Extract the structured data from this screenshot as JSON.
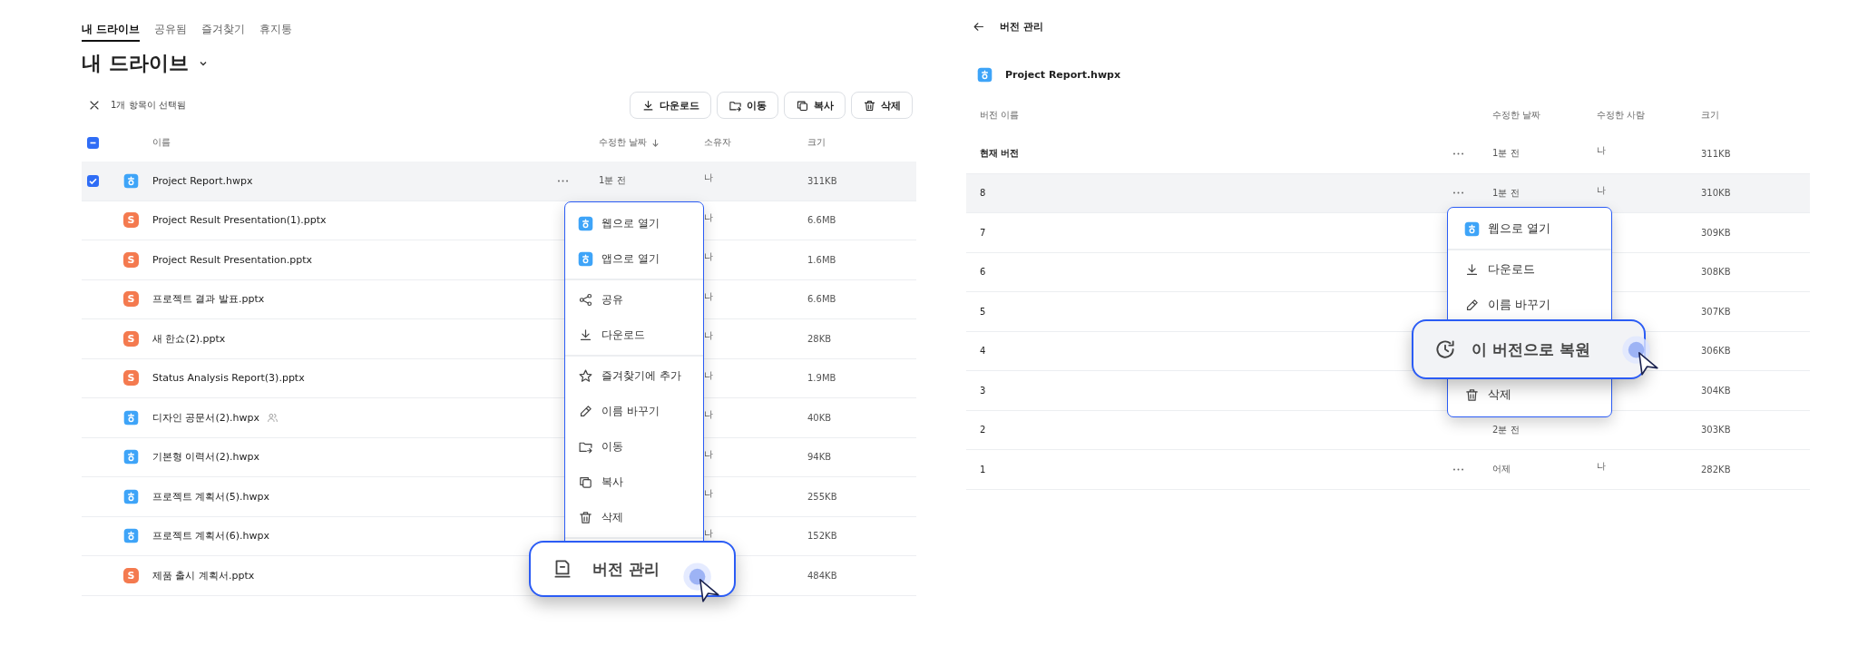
{
  "left": {
    "tabs": [
      {
        "label": "내 드라이브",
        "selected": true
      },
      {
        "label": "공유됨",
        "selected": false
      },
      {
        "label": "즐겨찾기",
        "selected": false
      },
      {
        "label": "휴지통",
        "selected": false
      }
    ],
    "title": "내 드라이브",
    "selection_text": "1개 항목이 선택됨",
    "actions": [
      {
        "label": "다운로드",
        "kind": "download"
      },
      {
        "label": "이동",
        "kind": "folder"
      },
      {
        "label": "복사",
        "kind": "copy"
      },
      {
        "label": "삭제",
        "kind": "trash"
      }
    ],
    "header_checkbox": {
      "kind": "partial"
    },
    "columns": [
      {
        "label": "이름",
        "sorted": false
      },
      {
        "label": "수정한 날짜",
        "sorted": true
      },
      {
        "label": "소유자",
        "sorted": false
      },
      {
        "label": "크기",
        "sorted": false
      }
    ],
    "rows": [
      {
        "name": "Project Report.hwpx",
        "kind": "hwp",
        "selected": true,
        "shared": false,
        "more": true,
        "modified": "1분 전",
        "owner": "나",
        "size": "311KB"
      },
      {
        "name": "Project Result Presentation(1).pptx",
        "kind": "show",
        "badge": "S",
        "selected": false,
        "shared": false,
        "more": false,
        "owner": "나",
        "size": "6.6MB"
      },
      {
        "name": "Project Result Presentation.pptx",
        "kind": "show",
        "badge": "S",
        "selected": false,
        "shared": false,
        "more": false,
        "owner": "나",
        "size": "1.6MB"
      },
      {
        "name": "프로젝트 결과 발표.pptx",
        "kind": "show",
        "badge": "S",
        "selected": false,
        "shared": false,
        "more": false,
        "owner": "나",
        "size": "6.6MB"
      },
      {
        "name": "새 한쇼(2).pptx",
        "kind": "show",
        "badge": "S",
        "selected": false,
        "shared": false,
        "more": false,
        "owner": "나",
        "size": "28KB"
      },
      {
        "name": "Status Analysis Report(3).pptx",
        "kind": "show",
        "badge": "S",
        "selected": false,
        "shared": false,
        "more": false,
        "owner": "나",
        "size": "1.9MB"
      },
      {
        "name": "디자인 공문서(2).hwpx",
        "kind": "hwp",
        "selected": false,
        "shared": true,
        "more": false,
        "owner": "나",
        "size": "40KB"
      },
      {
        "name": "기본형 이력서(2).hwpx",
        "kind": "hwp",
        "selected": false,
        "shared": false,
        "more": false,
        "owner": "나",
        "size": "94KB"
      },
      {
        "name": "프로젝트 계획서(5).hwpx",
        "kind": "hwp",
        "selected": false,
        "shared": false,
        "more": false,
        "owner": "나",
        "size": "255KB"
      },
      {
        "name": "프로젝트 계획서(6).hwpx",
        "kind": "hwp",
        "selected": false,
        "shared": false,
        "more": false,
        "owner": "나",
        "size": "152KB"
      },
      {
        "name": "제품 출시 계획서.pptx",
        "kind": "show",
        "badge": "S",
        "selected": false,
        "shared": false,
        "more": false,
        "size": "484KB"
      }
    ],
    "menu": {
      "items": [
        {
          "label": "웹으로 열기",
          "kind": "hwp",
          "magnified": false,
          "divider_after": false
        },
        {
          "label": "앱으로 열기",
          "kind": "hwp",
          "magnified": false,
          "divider_after": true
        },
        {
          "label": "공유",
          "kind": "share",
          "magnified": false,
          "divider_after": false
        },
        {
          "label": "다운로드",
          "kind": "download",
          "magnified": false,
          "divider_after": true
        },
        {
          "label": "즐겨찾기에 추가",
          "kind": "star",
          "magnified": false,
          "divider_after": false
        },
        {
          "label": "이름 바꾸기",
          "kind": "pencil",
          "magnified": false,
          "divider_after": false
        },
        {
          "label": "이동",
          "kind": "folder",
          "magnified": false,
          "divider_after": false
        },
        {
          "label": "복사",
          "kind": "copy",
          "magnified": false,
          "divider_after": false
        },
        {
          "label": "삭제",
          "kind": "trash",
          "magnified": false,
          "divider_after": true
        },
        {
          "label": "버전 관리",
          "kind": "version",
          "magnified": true,
          "divider_after": false
        }
      ]
    }
  },
  "right": {
    "title": "버전 관리",
    "file": {
      "name": "Project Report.hwpx",
      "kind": "hwp"
    },
    "columns": [
      {
        "label": "버전 이름"
      },
      {
        "label": "수정한 날짜"
      },
      {
        "label": "수정한 사람"
      },
      {
        "label": "크기"
      }
    ],
    "rows": [
      {
        "name": "현재 버전",
        "current": true,
        "selected": false,
        "more": true,
        "modified": "1분 전",
        "owner": "나",
        "size": "311KB"
      },
      {
        "name": "8",
        "current": false,
        "selected": true,
        "more": true,
        "modified": "1분 전",
        "owner": "나",
        "size": "310KB"
      },
      {
        "name": "7",
        "current": false,
        "selected": false,
        "more": false,
        "size": "309KB"
      },
      {
        "name": "6",
        "current": false,
        "selected": false,
        "more": false,
        "size": "308KB"
      },
      {
        "name": "5",
        "current": false,
        "selected": false,
        "more": false,
        "size": "307KB"
      },
      {
        "name": "4",
        "current": false,
        "selected": false,
        "more": false,
        "size": "306KB"
      },
      {
        "name": "3",
        "current": false,
        "selected": false,
        "more": false,
        "size": "304KB"
      },
      {
        "name": "2",
        "current": false,
        "selected": false,
        "more": false,
        "modified": "2분 전",
        "size": "303KB"
      },
      {
        "name": "1",
        "current": false,
        "selected": false,
        "more": true,
        "modified": "어제",
        "owner": "나",
        "size": "282KB"
      }
    ],
    "menu": {
      "items": [
        {
          "label": "웹으로 열기",
          "kind": "hwp",
          "magnified": false,
          "divider_after": true
        },
        {
          "label": "다운로드",
          "kind": "download",
          "magnified": false,
          "divider_after": false
        },
        {
          "label": "이름 바꾸기",
          "kind": "pencil",
          "magnified": false,
          "divider_after": false
        },
        {
          "label": "이 버전으로 복원",
          "kind": "restore",
          "magnified": true,
          "divider_after": false
        },
        {
          "label": "삭제",
          "kind": "trash",
          "magnified": false,
          "divider_after": false
        }
      ]
    }
  }
}
